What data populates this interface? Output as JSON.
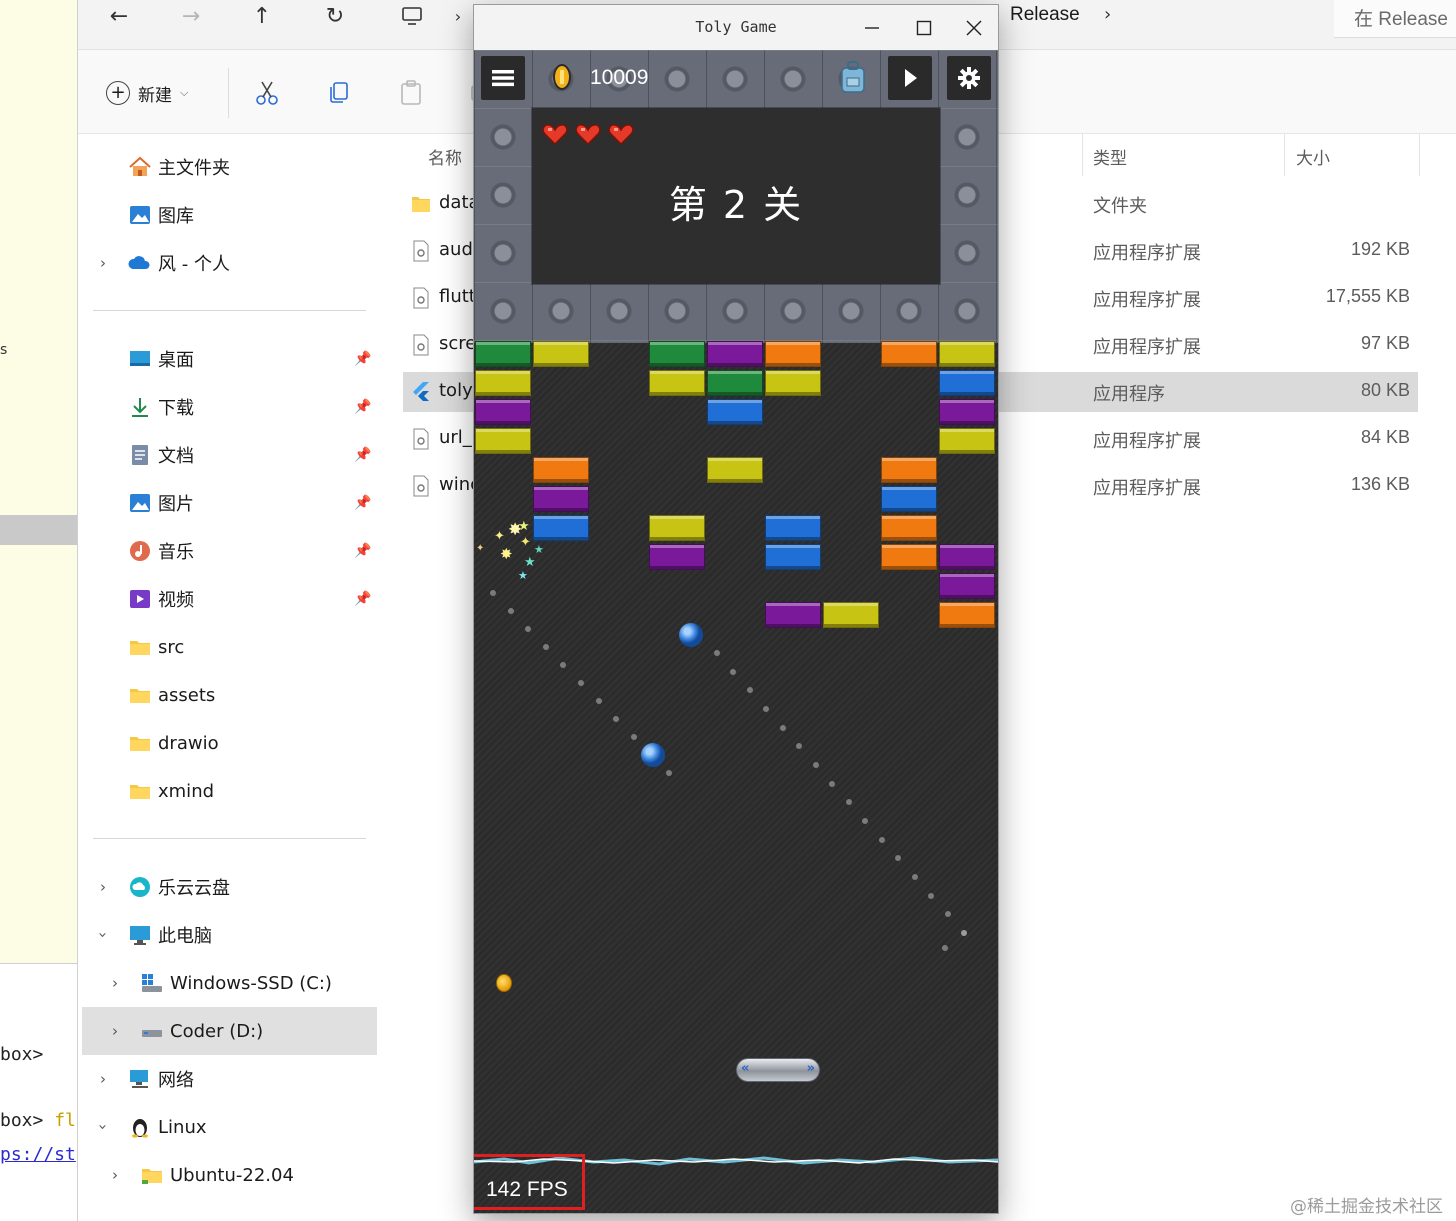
{
  "editor": {
    "terminal_lines": [
      {
        "prefix": "box>",
        "suffix": ""
      },
      {
        "prefix": "box>",
        "suffix": " fl"
      },
      {
        "prefix": "ps://st",
        "suffix": ""
      }
    ]
  },
  "explorer": {
    "breadcrumb": {
      "current": "Release"
    },
    "search": {
      "placeholder": "在 Release"
    },
    "toolbar": {
      "new_label": "新建"
    },
    "nav": {
      "home": "主文件夹",
      "gallery": "图库",
      "onedrive": "风 - 个人",
      "desktop": "桌面",
      "downloads": "下载",
      "documents": "文档",
      "pictures": "图片",
      "music": "音乐",
      "videos": "视频",
      "src": "src",
      "assets": "assets",
      "drawio": "drawio",
      "xmind": "xmind",
      "leyun": "乐云云盘",
      "this_pc": "此电脑",
      "drive_c": "Windows-SSD (C:)",
      "drive_d": "Coder (D:)",
      "network": "网络",
      "linux": "Linux",
      "ubuntu": "Ubuntu-22.04"
    },
    "columns": {
      "name": "名称",
      "type": "类型",
      "size": "大小"
    },
    "files": [
      {
        "name": "data",
        "type": "文件夹",
        "size": ""
      },
      {
        "name": "aud",
        "type": "应用程序扩展",
        "size": "192 KB"
      },
      {
        "name": "flutt",
        "type": "应用程序扩展",
        "size": "17,555 KB"
      },
      {
        "name": "scre",
        "type": "应用程序扩展",
        "size": "97 KB"
      },
      {
        "name": "toly",
        "type": "应用程序",
        "size": "80 KB"
      },
      {
        "name": "url_",
        "type": "应用程序扩展",
        "size": "84 KB"
      },
      {
        "name": "winc",
        "type": "应用程序扩展",
        "size": "136 KB"
      }
    ]
  },
  "game": {
    "window_title": "Toly Game",
    "coins": "10009",
    "lives": 3,
    "level_text": "第 2 关",
    "fps_text": "142 FPS",
    "colors": {
      "green": "#1f8a3b",
      "yellow": "#c8c414",
      "purple": "#7a1a9a",
      "orange": "#f07a10",
      "blue": "#1f6fd6"
    },
    "bricks": [
      {
        "col": 0,
        "row": 0,
        "color": "green"
      },
      {
        "col": 1,
        "row": 0,
        "color": "yellow"
      },
      {
        "col": 3,
        "row": 0,
        "color": "green"
      },
      {
        "col": 4,
        "row": 0,
        "color": "purple"
      },
      {
        "col": 5,
        "row": 0,
        "color": "orange"
      },
      {
        "col": 7,
        "row": 0,
        "color": "orange"
      },
      {
        "col": 8,
        "row": 0,
        "color": "yellow"
      },
      {
        "col": 0,
        "row": 1,
        "color": "yellow"
      },
      {
        "col": 3,
        "row": 1,
        "color": "yellow"
      },
      {
        "col": 4,
        "row": 1,
        "color": "green"
      },
      {
        "col": 5,
        "row": 1,
        "color": "yellow"
      },
      {
        "col": 8,
        "row": 1,
        "color": "blue"
      },
      {
        "col": 0,
        "row": 2,
        "color": "purple"
      },
      {
        "col": 4,
        "row": 2,
        "color": "blue"
      },
      {
        "col": 8,
        "row": 2,
        "color": "purple"
      },
      {
        "col": 0,
        "row": 3,
        "color": "yellow"
      },
      {
        "col": 8,
        "row": 3,
        "color": "yellow"
      },
      {
        "col": 1,
        "row": 4,
        "color": "orange"
      },
      {
        "col": 4,
        "row": 4,
        "color": "yellow"
      },
      {
        "col": 7,
        "row": 4,
        "color": "orange"
      },
      {
        "col": 1,
        "row": 5,
        "color": "purple"
      },
      {
        "col": 7,
        "row": 5,
        "color": "blue"
      },
      {
        "col": 1,
        "row": 6,
        "color": "blue"
      },
      {
        "col": 3,
        "row": 6,
        "color": "yellow"
      },
      {
        "col": 5,
        "row": 6,
        "color": "blue"
      },
      {
        "col": 7,
        "row": 6,
        "color": "orange"
      },
      {
        "col": 3,
        "row": 7,
        "color": "purple"
      },
      {
        "col": 5,
        "row": 7,
        "color": "blue"
      },
      {
        "col": 7,
        "row": 7,
        "color": "orange"
      },
      {
        "col": 8,
        "row": 7,
        "color": "purple"
      },
      {
        "col": 8,
        "row": 8,
        "color": "purple"
      },
      {
        "col": 5,
        "row": 9,
        "color": "purple"
      },
      {
        "col": 6,
        "row": 9,
        "color": "yellow"
      },
      {
        "col": 8,
        "row": 9,
        "color": "orange"
      }
    ]
  },
  "watermark": "@稀土掘金技术社区"
}
